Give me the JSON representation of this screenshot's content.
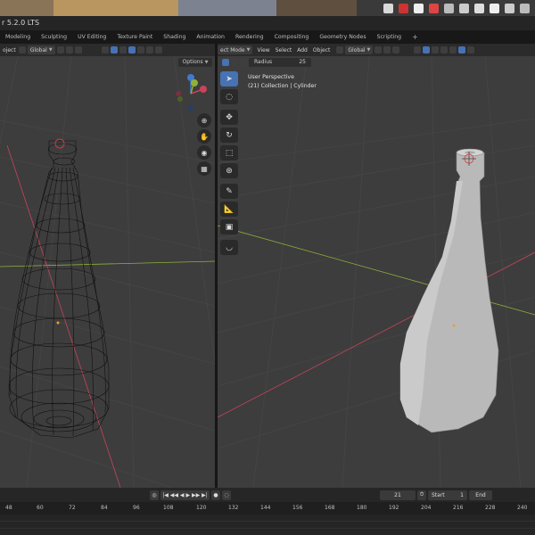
{
  "app": {
    "title": "r 5.2.0 LTS"
  },
  "workspace_tabs": [
    "Modeling",
    "Sculpting",
    "UV Editing",
    "Texture Paint",
    "Shading",
    "Animation",
    "Rendering",
    "Compositing",
    "Geometry Nodes",
    "Scripting",
    "+"
  ],
  "left_viewport": {
    "header": {
      "obj_label": "oject",
      "orientation": "Global",
      "options_label": "Options"
    }
  },
  "right_viewport": {
    "header": {
      "mode": "ect Mode",
      "menus": [
        "View",
        "Select",
        "Add",
        "Object"
      ],
      "orientation": "Global"
    },
    "radius_label": "Radius",
    "radius_value": "25",
    "overlay": {
      "view_name": "User Perspective",
      "collection": "(21) Collection | Cylinder"
    }
  },
  "gizmo": {
    "x": "X",
    "y": "Y",
    "z": "Z"
  },
  "timeline": {
    "current_frame": "21",
    "start_label": "Start",
    "start_value": "1",
    "end_label": "End",
    "ruler": [
      "48",
      "60",
      "72",
      "84",
      "96",
      "108",
      "120",
      "132",
      "144",
      "156",
      "168",
      "180",
      "192",
      "204",
      "216",
      "228",
      "240"
    ]
  },
  "colors": {
    "accent": "#4772b3",
    "viewport_bg": "#3d3d3d",
    "x_axis": "#c8445a",
    "y_axis": "#8fb03a"
  }
}
